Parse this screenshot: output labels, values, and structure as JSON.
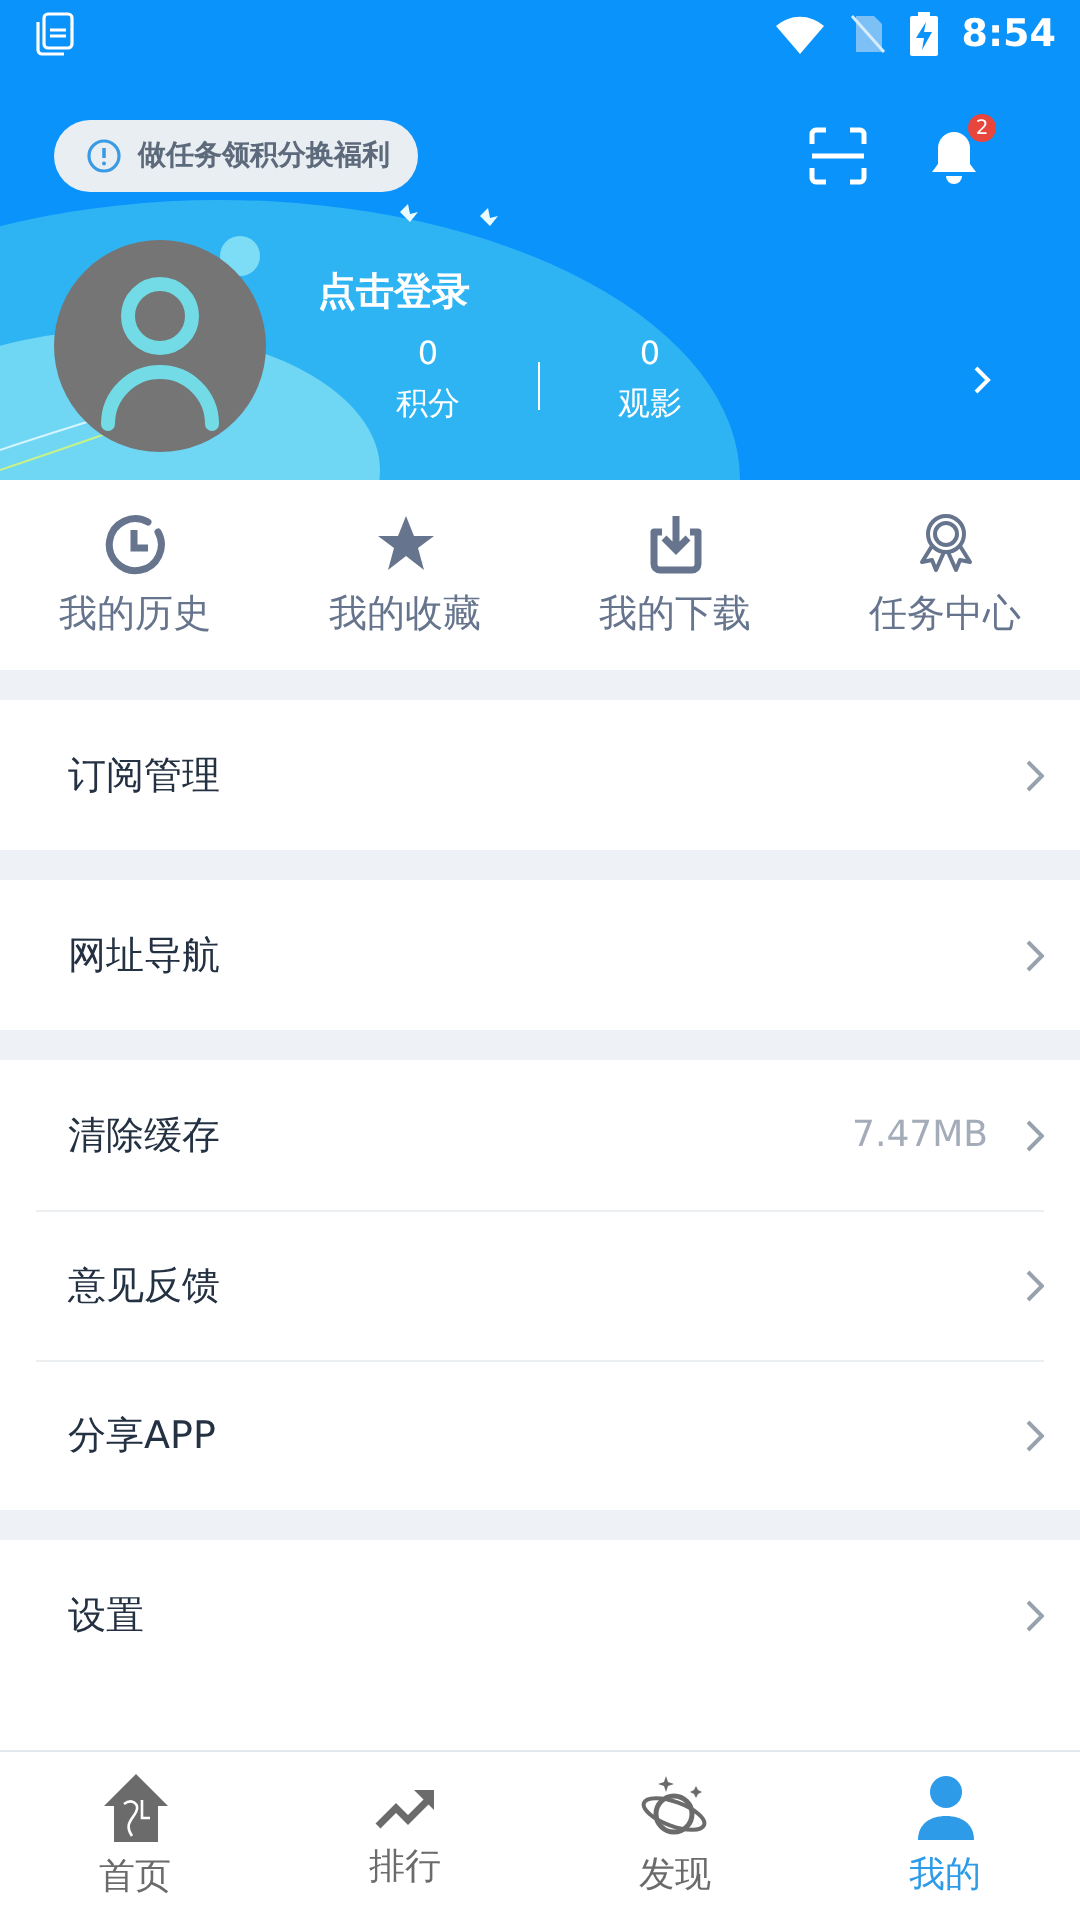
{
  "status_bar": {
    "time": "8:54"
  },
  "header": {
    "task_pill": "做任务领积分换福利",
    "notification_count": "2",
    "login": "点击登录",
    "stats": [
      {
        "value": "0",
        "label": "积分"
      },
      {
        "value": "0",
        "label": "观影"
      }
    ]
  },
  "shortcuts": [
    {
      "label": "我的历史"
    },
    {
      "label": "我的收藏"
    },
    {
      "label": "我的下载"
    },
    {
      "label": "任务中心"
    }
  ],
  "menu_groups": [
    [
      {
        "label": "订阅管理"
      }
    ],
    [
      {
        "label": "网址导航"
      }
    ],
    [
      {
        "label": "清除缓存",
        "value": "7.47MB"
      },
      {
        "label": "意见反馈"
      },
      {
        "label": "分享APP"
      }
    ],
    [
      {
        "label": "设置"
      }
    ]
  ],
  "nav": [
    {
      "label": "首页",
      "selected": false
    },
    {
      "label": "排行",
      "selected": false
    },
    {
      "label": "发现",
      "selected": false
    },
    {
      "label": "我的",
      "selected": true
    }
  ]
}
